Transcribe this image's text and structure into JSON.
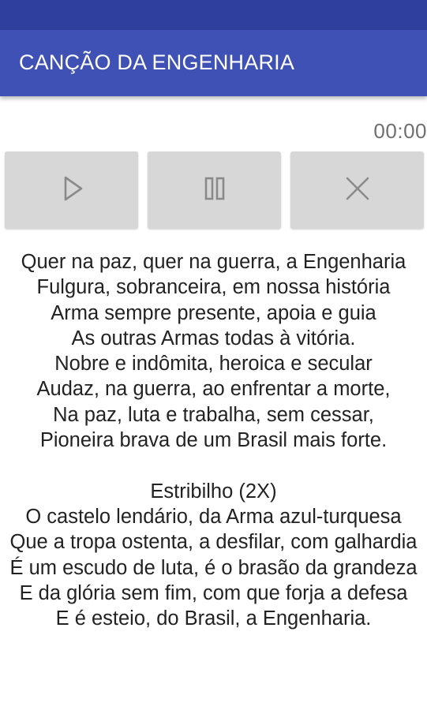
{
  "app_bar": {
    "title": "CANÇÃO DA ENGENHARIA"
  },
  "player": {
    "time": "00:00",
    "buttons": [
      {
        "icon": "play-icon"
      },
      {
        "icon": "pause-icon"
      },
      {
        "icon": "close-icon"
      }
    ]
  },
  "colors": {
    "status_bar": "#2f3f9c",
    "app_bar": "#3f51b5",
    "button_bg": "#d7d7d7",
    "icon": "#8a8a8a",
    "text": "#222222"
  },
  "lyrics": {
    "stanza1": [
      "Quer na paz, quer na guerra, a Engenharia",
      "Fulgura, sobranceira, em nossa história",
      "Arma sempre presente, apoia e guia",
      "As outras Armas todas à vitória.",
      "Nobre e indômita, heroica e secular",
      "Audaz, na guerra, ao enfrentar a morte,",
      "Na paz, luta e trabalha, sem cessar,",
      "Pioneira brava de um Brasil mais forte."
    ],
    "chorus_heading": "Estribilho (2X)",
    "chorus": [
      "O castelo lendário, da Arma azul-turquesa",
      "Que a tropa ostenta, a desfilar, com galhardia",
      "É um escudo de luta, é o brasão da grandeza",
      "E da glória sem fim, com que forja a defesa",
      "E é esteio, do Brasil, a Engenharia."
    ]
  }
}
